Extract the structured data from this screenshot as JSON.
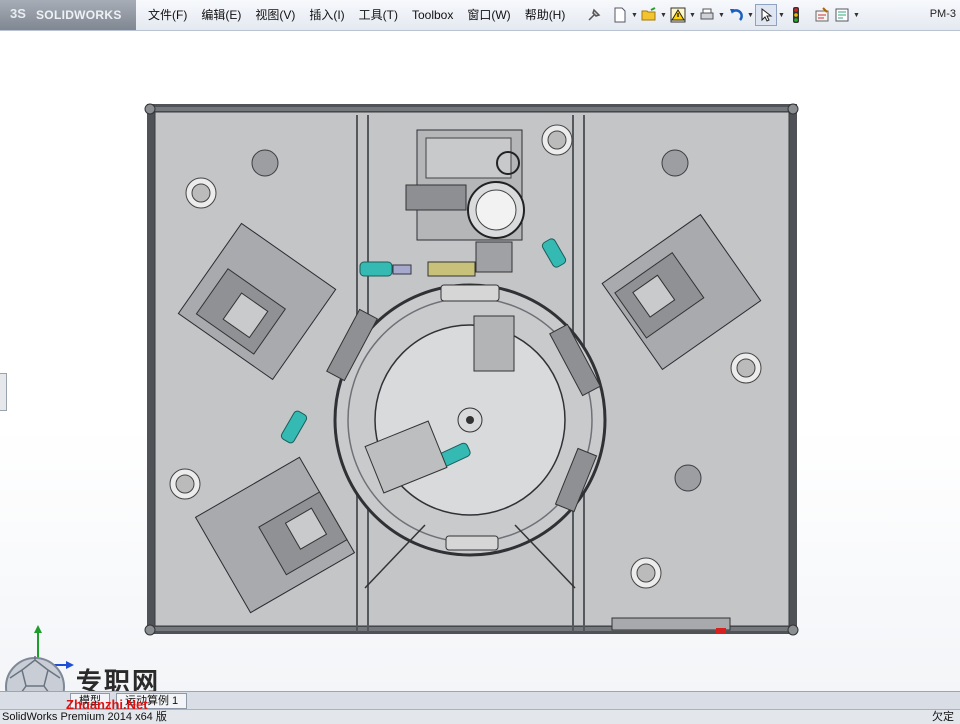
{
  "app": {
    "logo_text": "SOLIDWORKS",
    "logo_mark": "3S",
    "window_label": "PM-3"
  },
  "menu": [
    {
      "label": "文件(F)"
    },
    {
      "label": "编辑(E)"
    },
    {
      "label": "视图(V)"
    },
    {
      "label": "插入(I)"
    },
    {
      "label": "工具(T)"
    },
    {
      "label": "Toolbox"
    },
    {
      "label": "窗口(W)"
    },
    {
      "label": "帮助(H)"
    }
  ],
  "toolbar_icons": [
    "pin-icon",
    "new-document-icon",
    "open-folder-icon",
    "rebuild-warning-icon",
    "print-icon",
    "undo-icon",
    "select-arrow-icon",
    "traffic-light-icon",
    "options-icon",
    "file-properties-icon"
  ],
  "view_toolbar_icons": [
    "zoom-to-fit-icon",
    "zoom-to-area-icon",
    "previous-view-icon",
    "section-view-icon",
    "view-orientation-icon",
    "display-style-icon",
    "hide-show-items-icon",
    "edit-appearance-icon",
    "apply-scene-icon",
    "view-settings-icon"
  ],
  "tabs": [
    {
      "label": "模型"
    },
    {
      "label": "运动算例 1"
    }
  ],
  "status": {
    "left": "SolidWorks Premium 2014 x64 版",
    "right": "欠定"
  },
  "watermark": {
    "title": "专职网",
    "subtitle": "Zhuanzhi.Net"
  },
  "colors": {
    "plate": "#c3c4c6",
    "frame": "#5b5e63",
    "table": "#d6d7d9",
    "teal": "#34b9b3",
    "module": "#a9aaad"
  }
}
